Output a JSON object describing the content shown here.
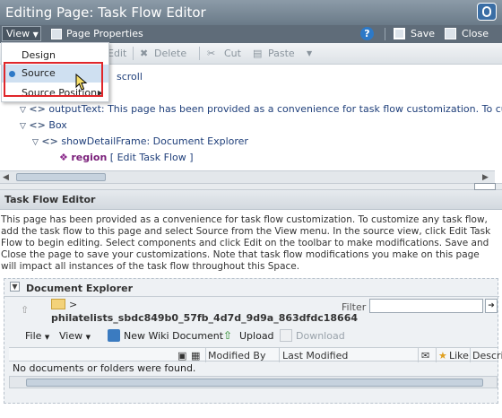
{
  "header": {
    "title_prefix": "Editing Page:",
    "title": "Task Flow Editor"
  },
  "toolbar": {
    "view_label": "View",
    "page_properties_label": "Page Properties",
    "help_symbol": "?",
    "save_label": "Save",
    "close_label": "Close"
  },
  "edit_toolbar": {
    "edit_label": "Edit",
    "delete_label": "Delete",
    "cut_label": "Cut",
    "paste_label": "Paste"
  },
  "view_menu": {
    "items": [
      {
        "label": "Design"
      },
      {
        "label": "Source",
        "selected": true
      },
      {
        "label": "Source Position"
      }
    ]
  },
  "tree": {
    "row1_text": "scroll",
    "row2_arrow": "▽",
    "row2_tag": "<>",
    "row2_text": "outputText: This page has been provided as a convenience for task flow customization. To customize any",
    "row3_arrow": "▽",
    "row3_tag": "<>",
    "row3_text": "Box",
    "row4_arrow": "▽",
    "row4_tag": "<>",
    "row4_text": "showDetailFrame: Document Explorer",
    "row5_name": "region",
    "row5_link_open": "[",
    "row5_link": "Edit Task Flow",
    "row5_link_close": "]"
  },
  "task_flow_editor": {
    "title": "Task Flow Editor",
    "description": "This page has been provided as a convenience for task flow customization. To customize any task flow, add the task flow to this page and select Source from the View menu. In the source view, click Edit Task Flow to begin editing. Select components and click Edit on the toolbar to make modifications. Save and Close the page to save your customizations. Note that task flow modifications you make on this page will impact all instances of the task flow throughout this Space."
  },
  "document_explorer": {
    "title": "Document Explorer",
    "breadcrumb_sep": ">",
    "folder_path": "philatelists_sbdc849b0_57fb_4d7d_9d9a_863dfdc18664",
    "filter_label": "Filter",
    "toolbar": {
      "file_label": "File",
      "view_label": "View",
      "new_wiki_label": "New Wiki Document",
      "upload_label": "Upload",
      "download_label": "Download"
    },
    "columns": [
      "Modified By",
      "Last Modified",
      "Like",
      "Descri"
    ],
    "empty_message": "No documents or folders were found."
  },
  "colors": {
    "header_bg": "#6a7a88",
    "menu_highlight": "#cfe0f1",
    "annotation_red": "#e0262a",
    "link_blue": "#1f3f7a"
  }
}
